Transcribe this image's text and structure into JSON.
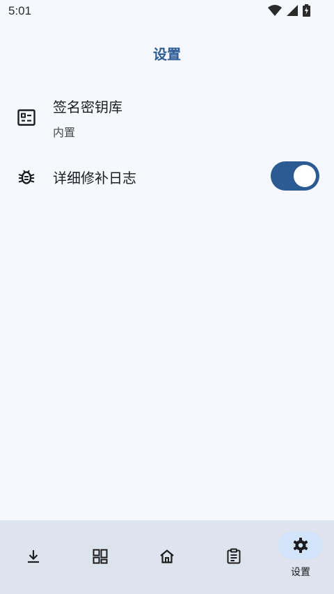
{
  "status_bar": {
    "time": "5:01",
    "icons": [
      "wifi-icon",
      "signal-icon",
      "battery-charging-icon"
    ]
  },
  "header": {
    "title": "设置"
  },
  "settings": [
    {
      "icon": "keystore-icon",
      "title": "签名密钥库",
      "subtitle": "内置"
    },
    {
      "icon": "bug-icon",
      "title": "详细修补日志",
      "toggle": true
    }
  ],
  "bottom_nav": {
    "items": [
      {
        "icon": "download-icon",
        "label": ""
      },
      {
        "icon": "dashboard-icon",
        "label": ""
      },
      {
        "icon": "home-icon",
        "label": ""
      },
      {
        "icon": "clipboard-icon",
        "label": ""
      },
      {
        "icon": "gear-icon",
        "label": "设置",
        "active": true
      }
    ]
  },
  "colors": {
    "accent": "#2c5b94",
    "background": "#f5f9ff",
    "nav_background": "#dde4ee",
    "active_pill": "#d3e3fa"
  }
}
